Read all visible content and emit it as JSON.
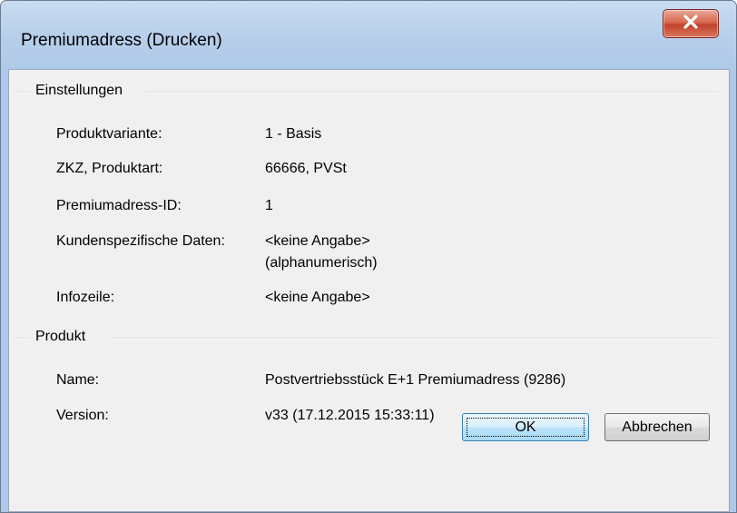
{
  "window": {
    "title": "Premiumadress (Drucken)"
  },
  "settings_group": {
    "title": "Einstellungen",
    "rows": [
      {
        "label": "Produktvariante:",
        "value": "1 - Basis"
      },
      {
        "label": "ZKZ, Produktart:",
        "value": "66666, PVSt"
      },
      {
        "label": "Premiumadress-ID:",
        "value": "1"
      },
      {
        "label": "Kundenspezifische Daten:",
        "value": "<keine Angabe>",
        "value_note": "(alphanumerisch)"
      },
      {
        "label": "Infozeile:",
        "value": "<keine Angabe>"
      }
    ]
  },
  "product_group": {
    "title": "Produkt",
    "rows": [
      {
        "label": "Name:",
        "value": "Postvertriebsstück E+1 Premiumadress (9286)"
      },
      {
        "label": "Version:",
        "value": "v33 (17.12.2015 15:33:11)"
      }
    ]
  },
  "buttons": {
    "ok": "OK",
    "cancel": "Abbrechen"
  }
}
